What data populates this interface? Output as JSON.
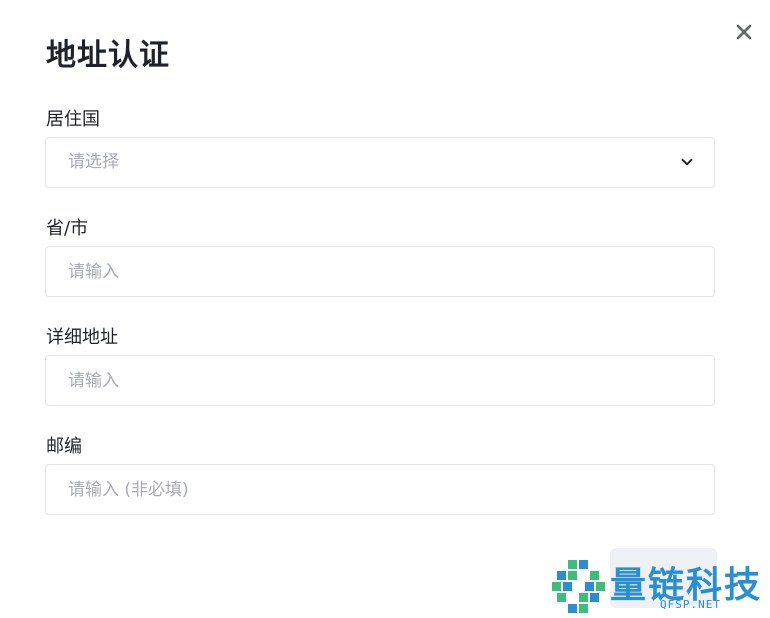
{
  "dialog": {
    "title": "地址认证",
    "close_icon": "close-icon"
  },
  "form": {
    "country": {
      "label": "居住国",
      "placeholder": "请选择",
      "icon": "chevron-down-icon"
    },
    "province": {
      "label": "省/市",
      "placeholder": "请输入",
      "value": ""
    },
    "address": {
      "label": "详细地址",
      "placeholder": "请输入",
      "value": ""
    },
    "zip": {
      "label": "邮编",
      "placeholder": "请输入 (非必填)",
      "value": ""
    }
  },
  "watermark": {
    "text": "量链科技",
    "sub": "QFSP.NET",
    "colors": {
      "blue": "#2a8fd1",
      "green": "#3dbd7d"
    }
  },
  "colors": {
    "text": "#1f2329",
    "placeholder": "#a8abb2",
    "border": "#e3e5e8"
  }
}
